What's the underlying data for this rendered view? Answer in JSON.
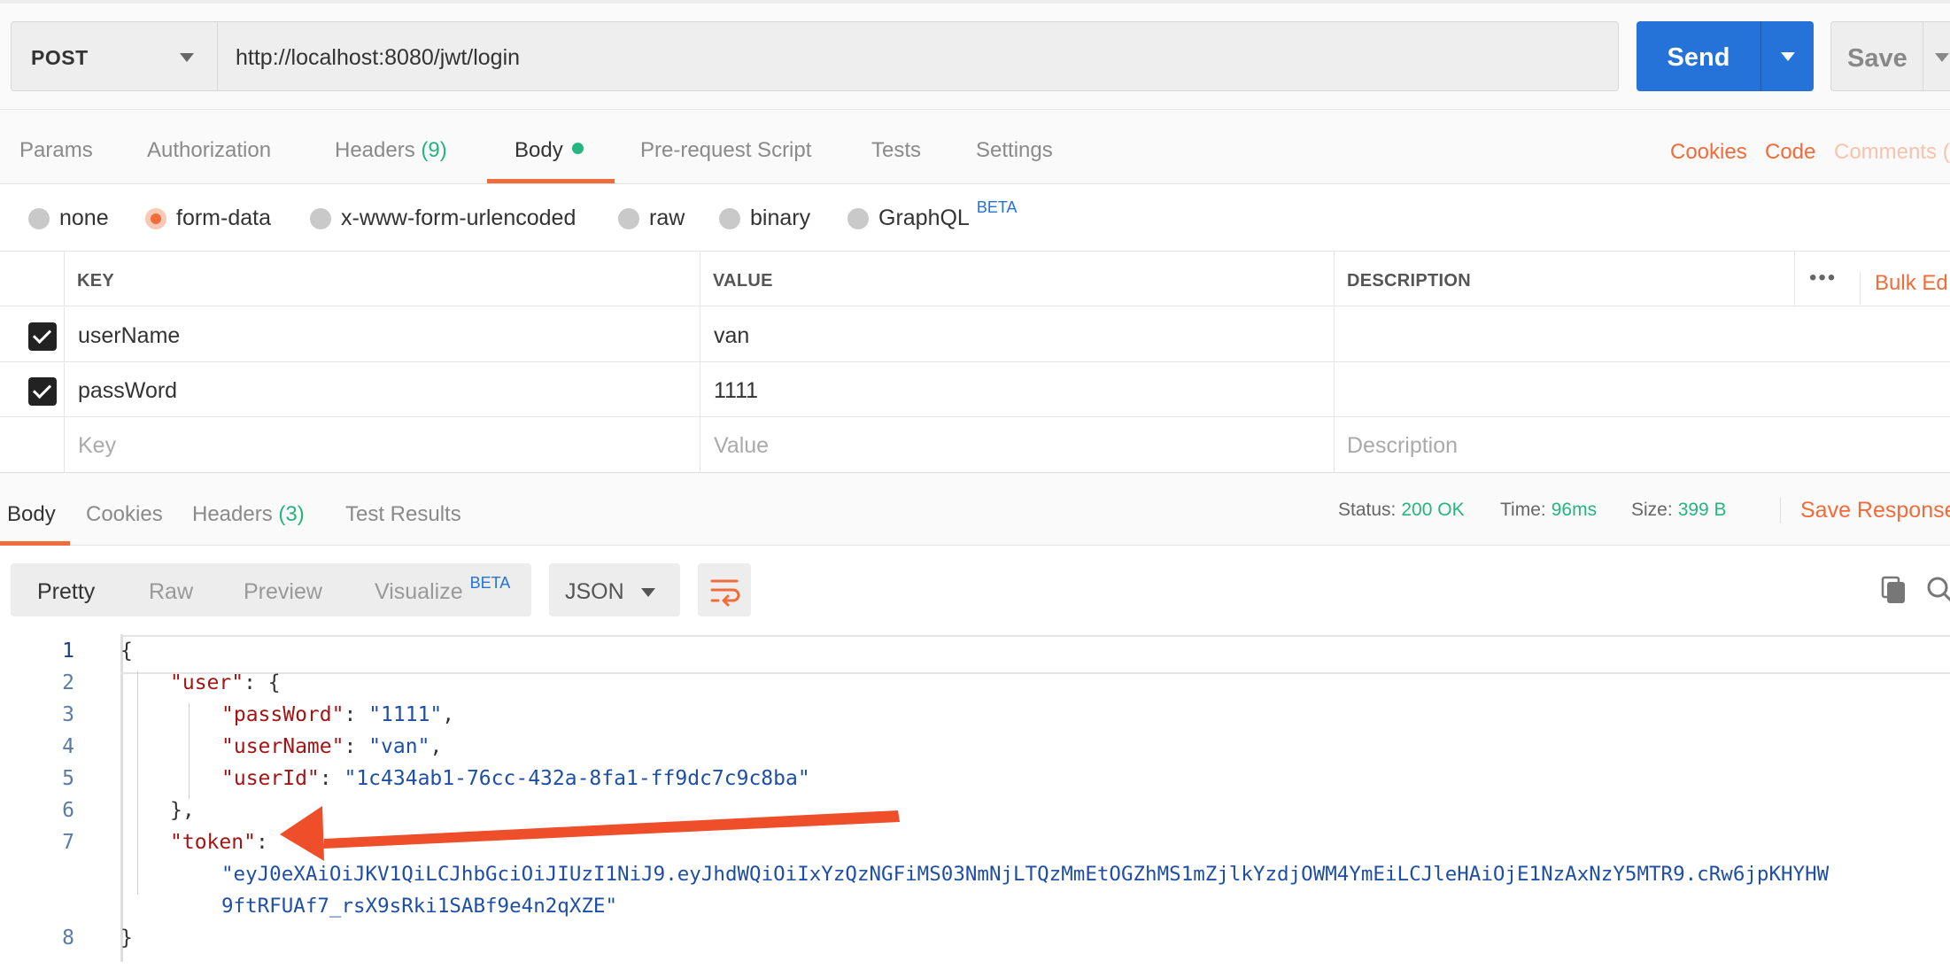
{
  "request": {
    "method": "POST",
    "url": "http://localhost:8080/jwt/login",
    "send_label": "Send",
    "save_label": "Save"
  },
  "request_tabs": {
    "params": "Params",
    "authorization": "Authorization",
    "headers": "Headers",
    "headers_count": "(9)",
    "body": "Body",
    "pre_request_script": "Pre-request Script",
    "tests": "Tests",
    "settings": "Settings",
    "cookies": "Cookies",
    "code": "Code",
    "comments": "Comments ("
  },
  "body_types": {
    "none": "none",
    "form_data": "form-data",
    "urlencoded": "x-www-form-urlencoded",
    "raw": "raw",
    "binary": "binary",
    "graphql": "GraphQL",
    "beta": "BETA",
    "selected": "form-data"
  },
  "params_table": {
    "headers": {
      "key": "KEY",
      "value": "VALUE",
      "description": "DESCRIPTION",
      "bulk_edit": "Bulk Ed"
    },
    "rows": [
      {
        "key": "userName",
        "value": "van",
        "description": ""
      },
      {
        "key": "passWord",
        "value": "1111",
        "description": ""
      }
    ],
    "placeholders": {
      "key": "Key",
      "value": "Value",
      "description": "Description"
    }
  },
  "response_tabs": {
    "body": "Body",
    "cookies": "Cookies",
    "headers": "Headers",
    "headers_count": "(3)",
    "test_results": "Test Results"
  },
  "response_status": {
    "status_label": "Status:",
    "status_value": "200 OK",
    "time_label": "Time:",
    "time_value": "96ms",
    "size_label": "Size:",
    "size_value": "399 B",
    "save_response": "Save Response"
  },
  "view_modes": {
    "pretty": "Pretty",
    "raw": "Raw",
    "preview": "Preview",
    "visualize": "Visualize",
    "beta": "BETA",
    "format": "JSON"
  },
  "code": {
    "line_numbers": [
      "1",
      "2",
      "3",
      "4",
      "5",
      "6",
      "7",
      "8"
    ],
    "open_brace": "{",
    "user_key": "\"user\"",
    "user_open": ": {",
    "password_key": "\"passWord\"",
    "password_val": "\"1111\"",
    "username_key": "\"userName\"",
    "username_val": "\"van\"",
    "userid_key": "\"userId\"",
    "userid_val": "\"1c434ab1-76cc-432a-8fa1-ff9dc7c9c8ba\"",
    "user_close": "},",
    "token_key": "\"token\"",
    "colon": ":",
    "comma": ",",
    "colon_space": ": ",
    "token_val_line1": "\"eyJ0eXAiOiJKV1QiLCJhbGciOiJIUzI1NiJ9.eyJhdWQiOiIxYzQzNGFiMS03NmNjLTQzMmEtOGZhMS1mZjlkYzdjOWM4YmEiLCJleHAiOjE1NzAxNzY5MTR9.cRw6jpKHYHW",
    "token_val_line2": "9ftRFUAf7_rsX9sRki1SABf9e4n2qXZE\"",
    "close_brace": "}"
  },
  "colors": {
    "accent_orange": "#f26b3a",
    "send_blue": "#2573d9",
    "status_green": "#26b47f",
    "json_key": "#a31515",
    "json_string": "#1f4ea5",
    "annotation_arrow": "#ee4e2a"
  },
  "icons": {
    "method_caret": "chevron-down-icon",
    "send_caret": "chevron-down-icon",
    "wrap": "wrap-lines-icon",
    "copy": "copy-icon",
    "search": "search-icon",
    "more": "more-dots-icon"
  }
}
